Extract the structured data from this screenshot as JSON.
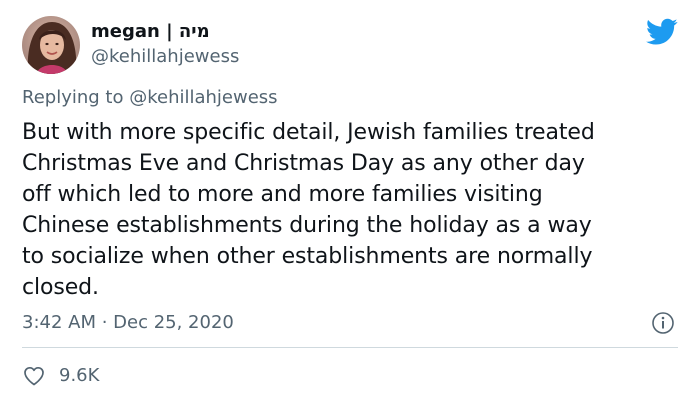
{
  "tweet": {
    "author_name": "megan | מיה",
    "author_handle": "@kehillahjewess",
    "reply_prefix": "Replying to",
    "reply_mention": "@kehillahjewess",
    "text_lines": [
      "But with more specific detail, Jewish families treated",
      "Christmas Eve and Christmas Day as any other day",
      "off which led to more and more families visiting",
      "Chinese establishments during the holiday as a way",
      "to socialize when other establishments are normally",
      "closed."
    ],
    "timestamp": "3:42 AM · Dec 25, 2020",
    "like_count": "9.6K"
  },
  "icons": {
    "logo": "twitter-bird-icon",
    "info": "info-icon",
    "like": "heart-icon"
  },
  "colors": {
    "brand": "#1d9bf0",
    "text": "#0f1419",
    "muted": "#536471",
    "divider": "#cfd9de"
  }
}
